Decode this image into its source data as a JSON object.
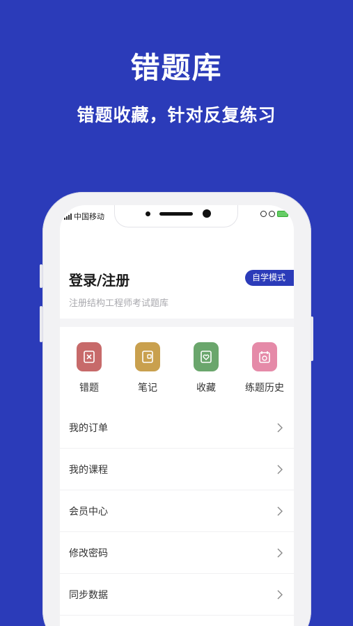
{
  "hero": {
    "title": "错题库",
    "subtitle": "错题收藏，针对反复练习"
  },
  "status_bar": {
    "carrier": "中国移动"
  },
  "profile": {
    "title": "登录/注册",
    "subtitle": "注册结构工程师考试题库",
    "mode_badge": "自学模式"
  },
  "quick_grid": [
    {
      "label": "错题",
      "icon": "wrong-questions-icon",
      "color": "#c76a6a"
    },
    {
      "label": "笔记",
      "icon": "notes-icon",
      "color": "#c9a04e"
    },
    {
      "label": "收藏",
      "icon": "favorites-icon",
      "color": "#6aa66c"
    },
    {
      "label": "练题历史",
      "icon": "practice-history-icon",
      "color": "#e58aa8"
    }
  ],
  "menu": [
    {
      "label": "我的订单"
    },
    {
      "label": "我的课程"
    },
    {
      "label": "会员中心"
    },
    {
      "label": "修改密码"
    },
    {
      "label": "同步数据"
    }
  ],
  "colors": {
    "background": "#2b3bb9",
    "accent": "#2b3bb9"
  }
}
